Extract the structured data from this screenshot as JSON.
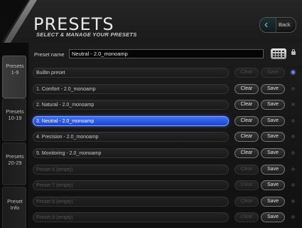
{
  "header": {
    "title": "PRESETS",
    "subtitle": "SELECT & MANAGE YOUR PRESETS",
    "back_label": "Back"
  },
  "sidebar": {
    "tabs": [
      {
        "label": "Presets\n1-9",
        "active": true
      },
      {
        "label": "Presets\n10-19",
        "active": false
      },
      {
        "label": "Presets\n20-29",
        "active": false
      },
      {
        "label": "Preset\nInfo",
        "active": false
      }
    ]
  },
  "preset_name": {
    "label": "Preset name",
    "value": "Neutral - 2.0_monoamp"
  },
  "buttons": {
    "clear_label": "Clear",
    "save_label": "Save"
  },
  "presets": [
    {
      "name": "Builtin preset",
      "selected": false,
      "empty": false,
      "clear_enabled": false,
      "save_enabled": false,
      "active": true
    },
    {
      "name": "1. Comfort - 2.0_monoamp",
      "selected": false,
      "empty": false,
      "clear_enabled": true,
      "save_enabled": true,
      "active": false
    },
    {
      "name": "2. Natural - 2.0_monoamp",
      "selected": false,
      "empty": false,
      "clear_enabled": true,
      "save_enabled": true,
      "active": false
    },
    {
      "name": "3. Neutral - 2.0_monoamp",
      "selected": true,
      "empty": false,
      "clear_enabled": true,
      "save_enabled": true,
      "active": false
    },
    {
      "name": "4. Precision - 2.0_monoamp",
      "selected": false,
      "empty": false,
      "clear_enabled": true,
      "save_enabled": true,
      "active": false
    },
    {
      "name": "5. Monitoring - 2.0_monoamp",
      "selected": false,
      "empty": false,
      "clear_enabled": true,
      "save_enabled": true,
      "active": false
    },
    {
      "name": "Preset 6 (empty)",
      "selected": false,
      "empty": true,
      "clear_enabled": false,
      "save_enabled": true,
      "active": false
    },
    {
      "name": "Preset 7 (empty)",
      "selected": false,
      "empty": true,
      "clear_enabled": false,
      "save_enabled": true,
      "active": false
    },
    {
      "name": "Preset 8 (empty)",
      "selected": false,
      "empty": true,
      "clear_enabled": false,
      "save_enabled": true,
      "active": false
    },
    {
      "name": "Preset 9 (empty)",
      "selected": false,
      "empty": true,
      "clear_enabled": false,
      "save_enabled": true,
      "active": false
    }
  ],
  "colors": {
    "accent": "#2f5fe0",
    "active_indicator": "#6f7ee0",
    "back_arrow": "#78c8d2"
  },
  "icons": {
    "back": "chevron-left-icon",
    "keyboard": "keyboard-icon",
    "lock": "lock-icon"
  }
}
